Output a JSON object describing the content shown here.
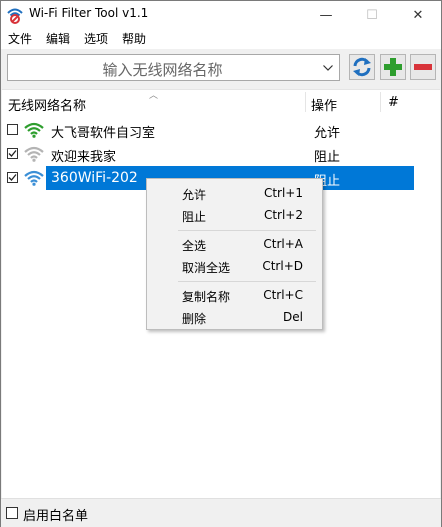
{
  "window": {
    "title": "Wi-Fi Filter Tool v1.1",
    "minimize": "—",
    "maximize": "☐",
    "close": "✕"
  },
  "menu": [
    "文件",
    "编辑",
    "选项",
    "帮助"
  ],
  "toolbar": {
    "input_placeholder": "输入无线网络名称",
    "refresh_icon": "refresh-icon",
    "add_icon": "plus-icon",
    "remove_icon": "minus-icon",
    "colors": {
      "refresh": "#1f6fbf",
      "add": "#2e9e2e",
      "remove": "#d8333a"
    }
  },
  "list": {
    "columns": [
      "无线网络名称",
      "操作",
      "#"
    ],
    "rows": [
      {
        "checked": false,
        "signal_color": "#2e9e2e",
        "name": "大飞哥软件自习室",
        "action": "允许",
        "selected": false
      },
      {
        "checked": true,
        "signal_color": "#b4b4b4",
        "name": "欢迎来我家",
        "action": "阻止",
        "selected": false
      },
      {
        "checked": true,
        "signal_color": "#3b8fd6",
        "name": "360WiFi-202",
        "action": "阻止",
        "selected": true
      }
    ]
  },
  "context_menu": {
    "items": [
      {
        "label": "允许",
        "shortcut": "Ctrl+1"
      },
      {
        "label": "阻止",
        "shortcut": "Ctrl+2"
      },
      {
        "label": "全选",
        "shortcut": "Ctrl+A"
      },
      {
        "label": "取消全选",
        "shortcut": "Ctrl+D"
      },
      {
        "label": "复制名称",
        "shortcut": "Ctrl+C"
      },
      {
        "label": "删除",
        "shortcut": "Del"
      }
    ]
  },
  "status": {
    "whitelist_label": "启用白名单",
    "whitelist_checked": false
  },
  "colors": {
    "selection": "#0078d7"
  }
}
